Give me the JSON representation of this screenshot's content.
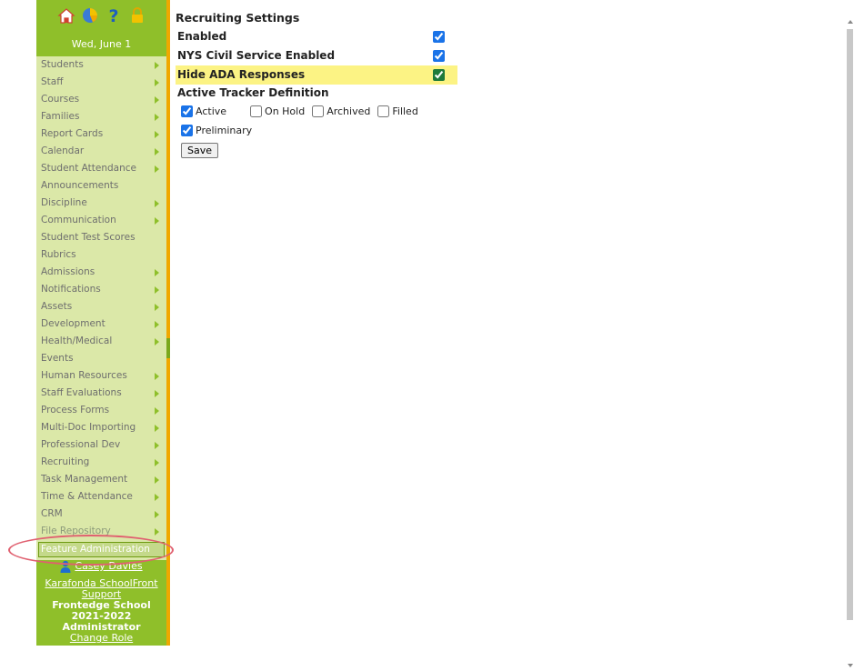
{
  "sidebar": {
    "date": "Wed, June 1",
    "icons": [
      "home-icon",
      "pie-chart-icon",
      "help-icon",
      "lock-icon"
    ],
    "menu": [
      {
        "label": "Students",
        "arrow": true
      },
      {
        "label": "Staff",
        "arrow": true
      },
      {
        "label": "Courses",
        "arrow": true
      },
      {
        "label": "Families",
        "arrow": true
      },
      {
        "label": "Report Cards",
        "arrow": true
      },
      {
        "label": "Calendar",
        "arrow": true
      },
      {
        "label": "Student Attendance",
        "arrow": true
      },
      {
        "label": "Announcements",
        "arrow": false
      },
      {
        "label": "Discipline",
        "arrow": true
      },
      {
        "label": "Communication",
        "arrow": true
      },
      {
        "label": "Student Test Scores",
        "arrow": false
      },
      {
        "label": "Rubrics",
        "arrow": false
      },
      {
        "label": "Admissions",
        "arrow": true
      },
      {
        "label": "Notifications",
        "arrow": true
      },
      {
        "label": "Assets",
        "arrow": true
      },
      {
        "label": "Development",
        "arrow": true
      },
      {
        "label": "Health/Medical",
        "arrow": true
      },
      {
        "label": "Events",
        "arrow": false
      },
      {
        "label": "Human Resources",
        "arrow": true
      },
      {
        "label": "Staff Evaluations",
        "arrow": true
      },
      {
        "label": "Process Forms",
        "arrow": true
      },
      {
        "label": "Multi-Doc Importing",
        "arrow": true
      },
      {
        "label": "Professional Dev",
        "arrow": true
      },
      {
        "label": "Recruiting",
        "arrow": true
      },
      {
        "label": "Task Management",
        "arrow": true
      },
      {
        "label": "Time & Attendance",
        "arrow": true
      },
      {
        "label": "CRM",
        "arrow": true
      },
      {
        "label": "File Repository",
        "arrow": true
      }
    ],
    "feature_admin": "Feature Administration",
    "user_name": "Casey Davies",
    "support_link": "Karafonda SchoolFront Support",
    "school": "Frontedge School",
    "year": "2021-2022",
    "role": "Administrator",
    "change_role": "Change Role"
  },
  "content": {
    "title": "Recruiting Settings",
    "settings": [
      {
        "label": "Enabled",
        "checked": true,
        "highlight": false
      },
      {
        "label": "NYS Civil Service Enabled",
        "checked": true,
        "highlight": false
      },
      {
        "label": "Hide ADA Responses",
        "checked": true,
        "highlight": true
      }
    ],
    "tracker_title": "Active Tracker Definition",
    "tracker_options": [
      {
        "label": "Active",
        "checked": true
      },
      {
        "label": "On Hold",
        "checked": false
      },
      {
        "label": "Archived",
        "checked": false
      },
      {
        "label": "Filled",
        "checked": false
      },
      {
        "label": "Preliminary",
        "checked": true
      }
    ],
    "save_label": "Save"
  },
  "colors": {
    "sidebar": "#8fbf2a",
    "menu_bg": "#dbe8a8",
    "accent_border": "#f0a800",
    "highlight": "#fcf384",
    "annotation_oval": "#e06070"
  }
}
